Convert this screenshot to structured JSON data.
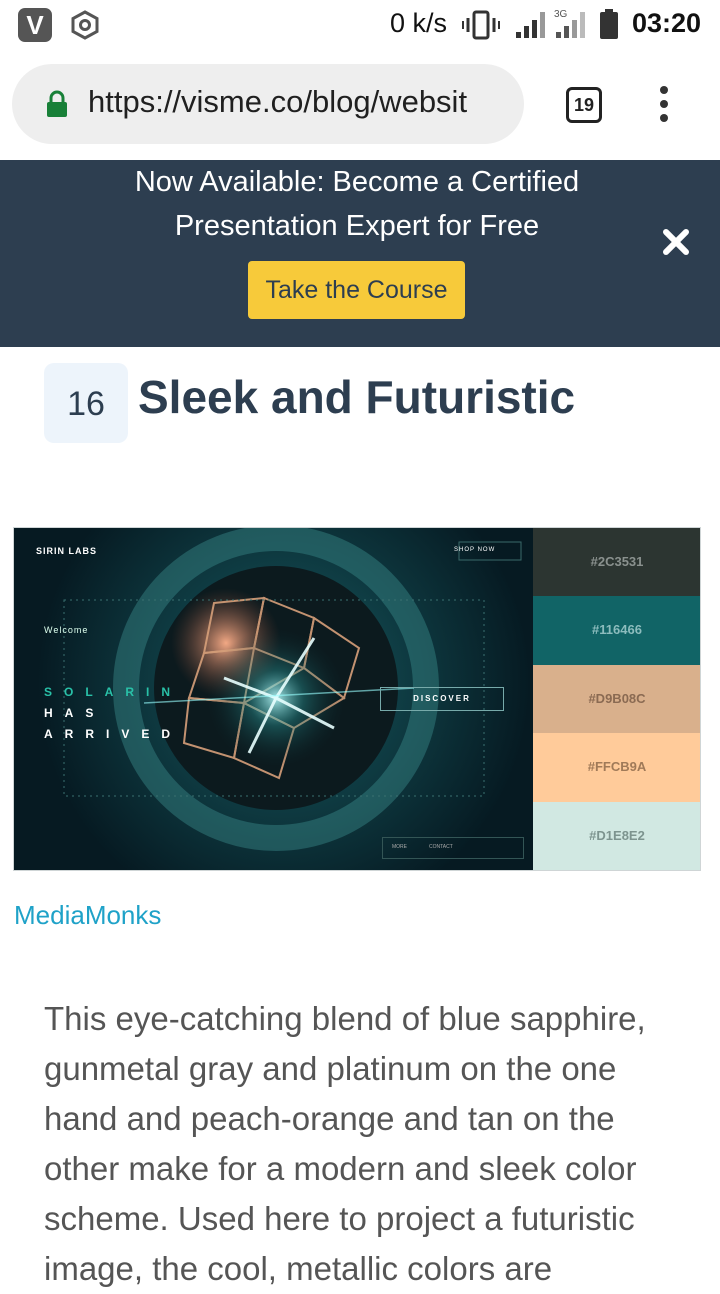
{
  "status_bar": {
    "app_icon_letter": "V",
    "net_speed": "0 k/s",
    "network_label": "3G",
    "time": "03:20"
  },
  "browser": {
    "url": "https://visme.co/blog/websit",
    "tab_count": "19"
  },
  "banner": {
    "line1": "Now Available: Become a Certified",
    "line2": "Presentation Expert for Free",
    "button": "Take the Course"
  },
  "section": {
    "number": "16",
    "title": "Sleek and Futuristic"
  },
  "screenshot": {
    "logo": "SIRIN LABS",
    "shop_now": "SHOP NOW",
    "welcome": "Welcome",
    "line1": "SOLARIN",
    "line2": "HAS",
    "line3": "ARRIVED",
    "discover": "DISCOVER",
    "more": "MORE",
    "contact": "CONTACT"
  },
  "palette": [
    {
      "hex": "#2C3531",
      "color": "#2c3531",
      "text_color": "#8a918e"
    },
    {
      "hex": "#116466",
      "color": "#116466",
      "text_color": "#8cbcbd"
    },
    {
      "hex": "#D9B08C",
      "color": "#d9b08c",
      "text_color": "#8a6a52"
    },
    {
      "hex": "#FFCB9A",
      "color": "#ffcb9a",
      "text_color": "#a07a58"
    },
    {
      "hex": "#D1E8E2",
      "color": "#d1e8e2",
      "text_color": "#7d948f"
    }
  ],
  "credit": "MediaMonks",
  "paragraph": "This eye-catching blend of blue sapphire, gunmetal gray and platinum on the one hand and peach-orange and tan on the other make for a modern and sleek color scheme. Used here to project a futuristic image, the cool, metallic colors are"
}
